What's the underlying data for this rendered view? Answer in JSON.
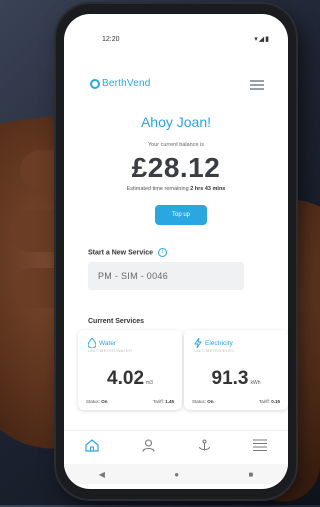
{
  "status_bar": {
    "time": "12:20",
    "icons": "▾◢▮"
  },
  "header": {
    "logo_text": "BerthVend"
  },
  "home": {
    "greeting": "Ahoy Joan!",
    "balance_caption": "Your current balance is",
    "balance": "£28.12",
    "time_remaining_label": "Estimated time remaining",
    "time_remaining_value": "2 hrs 43 mins",
    "topup_label": "Top up"
  },
  "new_service": {
    "title": "Start a New Service",
    "info_icon": "info-icon",
    "input_value": "PM - SIM - 0046"
  },
  "current_services": {
    "title": "Current Services",
    "cards": [
      {
        "icon": "water-drop-icon",
        "title": "Water",
        "sub": "UNIT/METER/WATER",
        "value": "4.02",
        "unit": "m3",
        "status_label": "Status:",
        "status_value": "On",
        "tariff_label": "Tariff:",
        "tariff_value": "1.45"
      },
      {
        "icon": "lightning-icon",
        "title": "Electricity",
        "sub": "UNIT/METER/ELEC",
        "value": "91.3",
        "unit": "kWh",
        "status_label": "Status:",
        "status_value": "On",
        "tariff_label": "Tariff:",
        "tariff_value": "0.15"
      }
    ]
  },
  "bottom_nav": [
    {
      "icon": "home-icon"
    },
    {
      "icon": "user-icon"
    },
    {
      "icon": "anchor-icon"
    },
    {
      "icon": "list-icon"
    }
  ],
  "system_nav": [
    "◀",
    "●",
    "■"
  ],
  "colors": {
    "accent": "#2aa7e0",
    "text": "#333333"
  }
}
